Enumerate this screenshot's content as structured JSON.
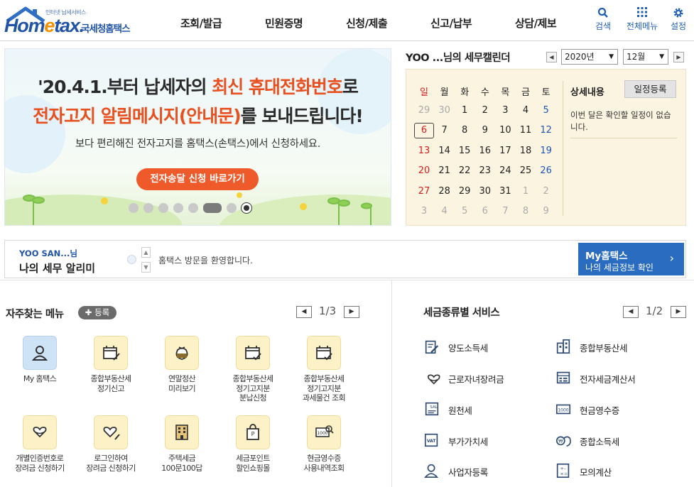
{
  "header": {
    "logo_tagline": "인터넷 납세서비스",
    "logo_word_a": "Hom",
    "logo_word_e": "e",
    "logo_word_b": "tax.",
    "logo_kr": "국세청홈택스",
    "nav": [
      "조회/발급",
      "민원증명",
      "신청/제출",
      "신고/납부",
      "상담/제보"
    ],
    "icons": [
      {
        "label": "검색",
        "icon": "search-icon"
      },
      {
        "label": "전체메뉴",
        "icon": "grid-icon"
      },
      {
        "label": "설정",
        "icon": "gear-icon"
      }
    ]
  },
  "banner": {
    "line1_a": "'20.4.1.부터 납세자의 ",
    "line1_red": "최신 휴대전화번호",
    "line1_b": "로",
    "line2_red": "전자고지 알림메시지(안내문)",
    "line2_b": "를 보내드립니다!",
    "line3": "보다 편리해진 전자고지를 홈택스(손택스)에서 신청하세요.",
    "button": "전자송달 신청 바로가기",
    "slide_count": 8,
    "active_slide": 6
  },
  "calendar": {
    "title": "YOO ...님의 세무캘린더",
    "year": "2020년",
    "month": "12월",
    "weekdays": [
      "일",
      "월",
      "화",
      "수",
      "목",
      "금",
      "토"
    ],
    "weeks": [
      [
        "29",
        "30",
        "1",
        "2",
        "3",
        "4",
        "5"
      ],
      [
        "6",
        "7",
        "8",
        "9",
        "10",
        "11",
        "12"
      ],
      [
        "13",
        "14",
        "15",
        "16",
        "17",
        "18",
        "19"
      ],
      [
        "20",
        "21",
        "22",
        "23",
        "24",
        "25",
        "26"
      ],
      [
        "27",
        "28",
        "29",
        "30",
        "31",
        "1",
        "2"
      ],
      [
        "3",
        "4",
        "5",
        "6",
        "7",
        "8",
        "9"
      ]
    ],
    "today": "6",
    "detail_label": "상세내용",
    "schedule_button": "일정등록",
    "detail_text": "이번 달은 확인할 일정이 없습니다."
  },
  "alert": {
    "user": "YOO SAN...님",
    "title": "나의 세무 알리미",
    "message": "홈택스 방문을 환영합니다.",
    "my_title": "My홈택스",
    "my_sub": "나의 세금정보 확인"
  },
  "favorites": {
    "title": "자주찾는 메뉴",
    "add_button": "등록",
    "page": "1/3",
    "items": [
      {
        "label": "My 홈택스",
        "icon": "user-icon"
      },
      {
        "label": "종합부동산세\n정기신고",
        "icon": "calendar-pen-icon"
      },
      {
        "label": "연말정산\n미리보기",
        "icon": "money-bag-icon"
      },
      {
        "label": "종합부동산세\n정기고지분\n분납신청",
        "icon": "calendar-check-icon"
      },
      {
        "label": "종합부동산세\n정기고지분\n과세물건 조회",
        "icon": "calendar-check-icon"
      },
      {
        "label": "개별인증번호로\n장려금 신청하기",
        "icon": "heart-hand-icon"
      },
      {
        "label": "로그인하여\n장려금 신청하기",
        "icon": "heart-hand-pen-icon"
      },
      {
        "label": "주택세금\n100문100답",
        "icon": "building-icon"
      },
      {
        "label": "세금포인트\n할인쇼핑몰",
        "icon": "shopping-bag-icon"
      },
      {
        "label": "현금영수증\n사용내역조회",
        "icon": "receipt-search-icon"
      }
    ]
  },
  "taxes": {
    "title": "세금종류별 서비스",
    "page": "1/2",
    "items": [
      {
        "label": "양도소득세",
        "icon": "document-pen-icon"
      },
      {
        "label": "종합부동산세",
        "icon": "buildings-icon"
      },
      {
        "label": "근로자녀장려금",
        "icon": "heart-hand-icon"
      },
      {
        "label": "전자세금계산서",
        "icon": "invoice-icon"
      },
      {
        "label": "원천세",
        "icon": "salary-icon"
      },
      {
        "label": "현금영수증",
        "icon": "cash-receipt-icon"
      },
      {
        "label": "부가가치세",
        "icon": "vat-icon"
      },
      {
        "label": "종합소득세",
        "icon": "coin-bag-icon"
      },
      {
        "label": "사업자등록",
        "icon": "person-icon"
      },
      {
        "label": "모의계산",
        "icon": "calculator-icon"
      }
    ]
  }
}
